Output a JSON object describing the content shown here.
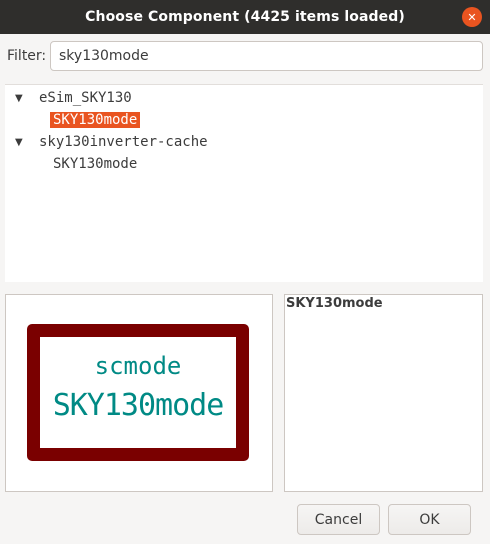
{
  "window": {
    "title": "Choose Component (4425 items loaded)",
    "close_glyph": "✕"
  },
  "filter": {
    "label": "Filter:",
    "value": "sky130mode"
  },
  "tree": {
    "groups": [
      {
        "expander": "▼",
        "label": "eSim_SKY130",
        "children": [
          {
            "label": "SKY130mode",
            "selected": true
          }
        ]
      },
      {
        "expander": "▼",
        "label": "sky130inverter-cache",
        "children": [
          {
            "label": "SKY130mode",
            "selected": false
          }
        ]
      }
    ]
  },
  "preview": {
    "reference": "scmode",
    "value": "SKY130mode",
    "body_color": "#7a0000",
    "text_color": "#008a85"
  },
  "details": {
    "title": "SKY130mode"
  },
  "buttons": {
    "cancel": "Cancel",
    "ok": "OK"
  },
  "colors": {
    "accent": "#e95420",
    "titlebar": "#2f2e2c"
  }
}
